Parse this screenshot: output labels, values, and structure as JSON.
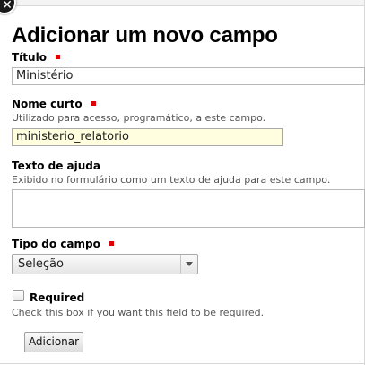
{
  "dialog": {
    "title": "Adicionar um novo campo",
    "fields": {
      "title": {
        "label": "Título",
        "value": "Ministério"
      },
      "short_name": {
        "label": "Nome curto",
        "help": "Utilizado para acesso, programático, a este campo.",
        "value": "ministerio_relatorio"
      },
      "help_text": {
        "label": "Texto de ajuda",
        "help": "Exibido no formulário como um texto de ajuda para este campo.",
        "value": ""
      },
      "field_type": {
        "label": "Tipo do campo",
        "selected": "Seleção"
      },
      "required": {
        "label": "Required",
        "help": "Check this box if you want this field to be required.",
        "checked": false
      }
    },
    "submit_label": "Adicionar"
  },
  "colors": {
    "required_marker": "#dd0000",
    "focused_input_bg": "#ffffe0"
  }
}
